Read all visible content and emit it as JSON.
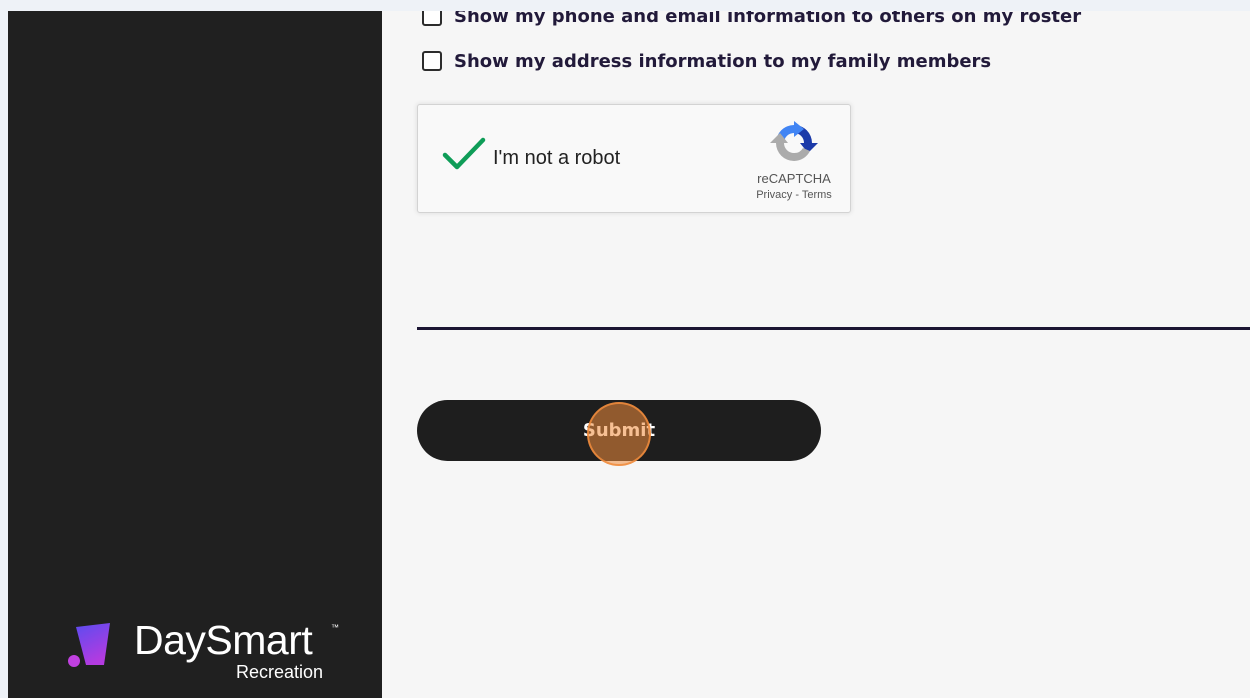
{
  "brand": {
    "name": "DaySmart",
    "trademark": "™",
    "subtitle": "Recreation",
    "colors": {
      "mark_top": "#5b4cf0",
      "mark_bottom": "#b33be0",
      "dot": "#c040e0"
    }
  },
  "form": {
    "options": [
      {
        "label": "Show my phone and email information to others on my roster",
        "checked": false
      },
      {
        "label": "Show my address information to my family members",
        "checked": false
      }
    ],
    "captcha": {
      "label": "I'm not a robot",
      "checked": true,
      "brand": "reCAPTCHA",
      "privacy": "Privacy",
      "separator": " - ",
      "terms": "Terms",
      "check_color": "#0f9d58"
    },
    "submit_label": "Submit"
  },
  "overlay": {
    "click_marker_color": "#f08c3c"
  }
}
